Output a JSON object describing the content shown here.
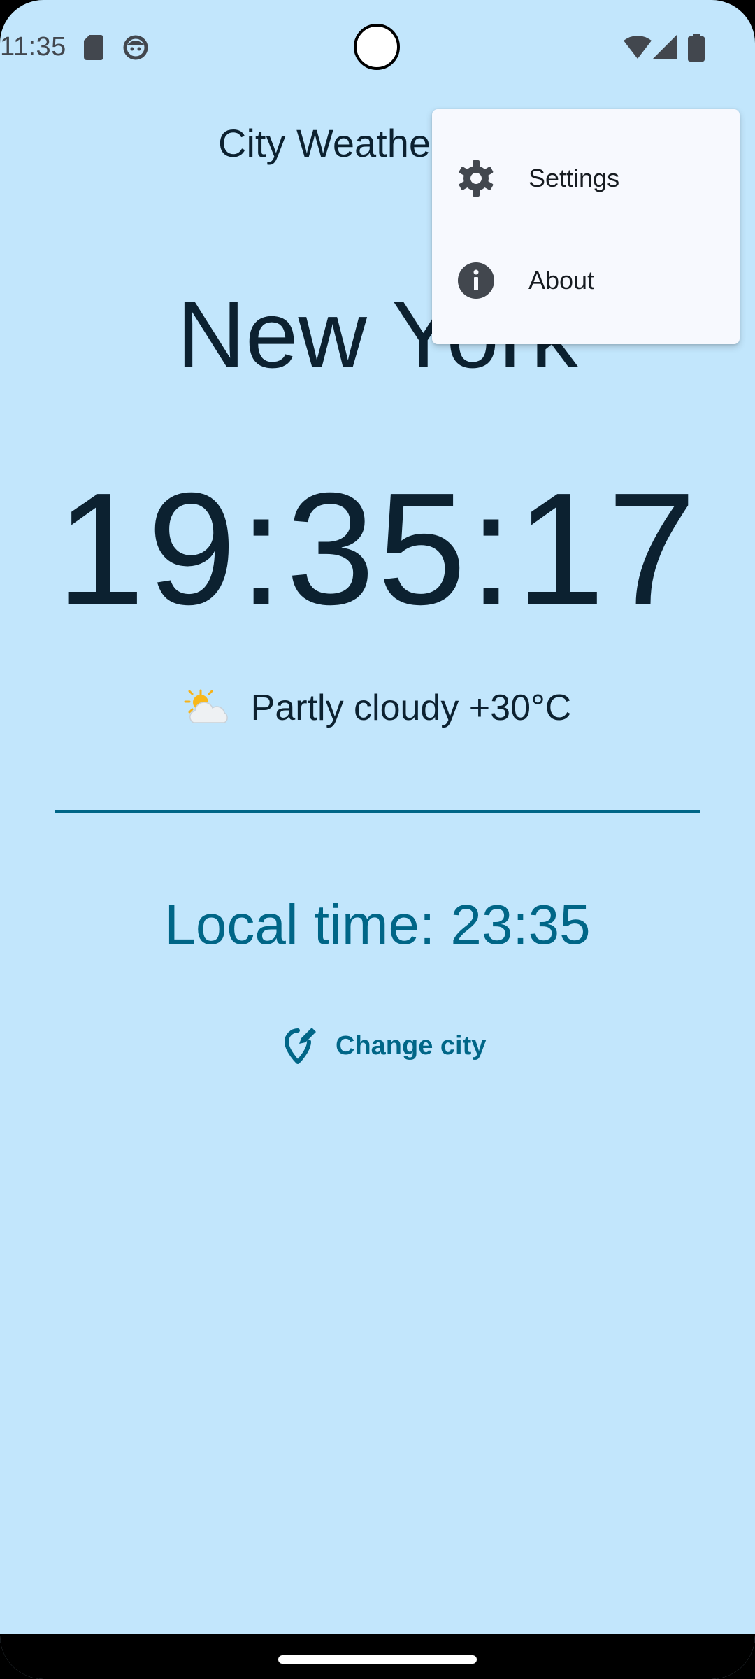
{
  "status_bar": {
    "time": "11:35",
    "icons": [
      "sd-card-icon",
      "face-icon",
      "wifi-icon",
      "cell-signal-icon",
      "battery-icon"
    ]
  },
  "app_bar": {
    "title": "City Weather"
  },
  "main": {
    "city": "New York",
    "clock": "19:35:17",
    "weather_icon": "partly-cloudy-icon",
    "weather_text": "Partly cloudy +30°C",
    "local_time": "Local time: 23:35",
    "change_city_label": "Change city"
  },
  "menu": {
    "items": [
      {
        "label": "Settings",
        "icon": "gear-icon"
      },
      {
        "label": "About",
        "icon": "info-icon"
      }
    ]
  },
  "colors": {
    "background": "#c2e6fc",
    "primary_text": "#0c2130",
    "accent": "#006687",
    "menu_surface": "#f7f9fe"
  }
}
